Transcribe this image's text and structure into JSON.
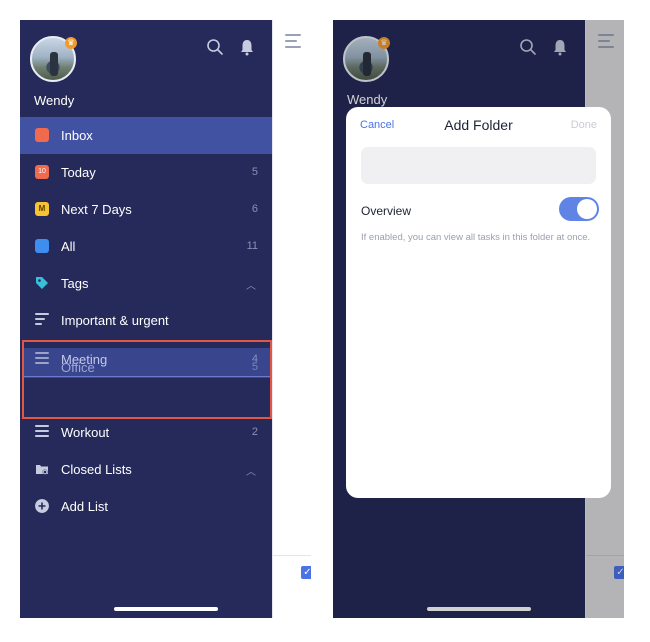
{
  "user": {
    "name": "Wendy"
  },
  "icons": {
    "search": "search-icon",
    "bell": "bell-icon",
    "crown": "crown-icon",
    "menu": "menu-icon"
  },
  "colors": {
    "sidebar": "#252a5a",
    "active": "#4152a3",
    "accent": "#4b73e6",
    "highlight": "#e15744"
  },
  "nav": [
    {
      "label": "Inbox",
      "count": "",
      "icon": "inbox-icon",
      "active": true
    },
    {
      "label": "Today",
      "count": "5",
      "icon": "calendar-today-icon",
      "badge": "10"
    },
    {
      "label": "Next 7 Days",
      "count": "6",
      "icon": "calendar-week-icon",
      "badge": "M"
    },
    {
      "label": "All",
      "count": "11",
      "icon": "stack-icon"
    },
    {
      "label": "Tags",
      "count": "",
      "icon": "tag-icon"
    },
    {
      "label": "Important & urgent",
      "count": "",
      "icon": "filter-icon"
    }
  ],
  "drag": {
    "label_a": "Meeting",
    "count_a": "4",
    "label_b": "Office",
    "count_b": "5"
  },
  "nav_lower": [
    {
      "label": "Workout",
      "count": "2",
      "icon": "list-icon"
    },
    {
      "label": "Closed Lists",
      "count": "",
      "icon": "archive-folder-icon"
    },
    {
      "label": "Add List",
      "count": "",
      "icon": "plus-circle-icon"
    }
  ],
  "sheet": {
    "cancel": "Cancel",
    "title": "Add Folder",
    "done": "Done",
    "input_value": "",
    "overview_label": "Overview",
    "overview_enabled": true,
    "overview_help": "If enabled, you can view all tasks in this folder at once."
  }
}
